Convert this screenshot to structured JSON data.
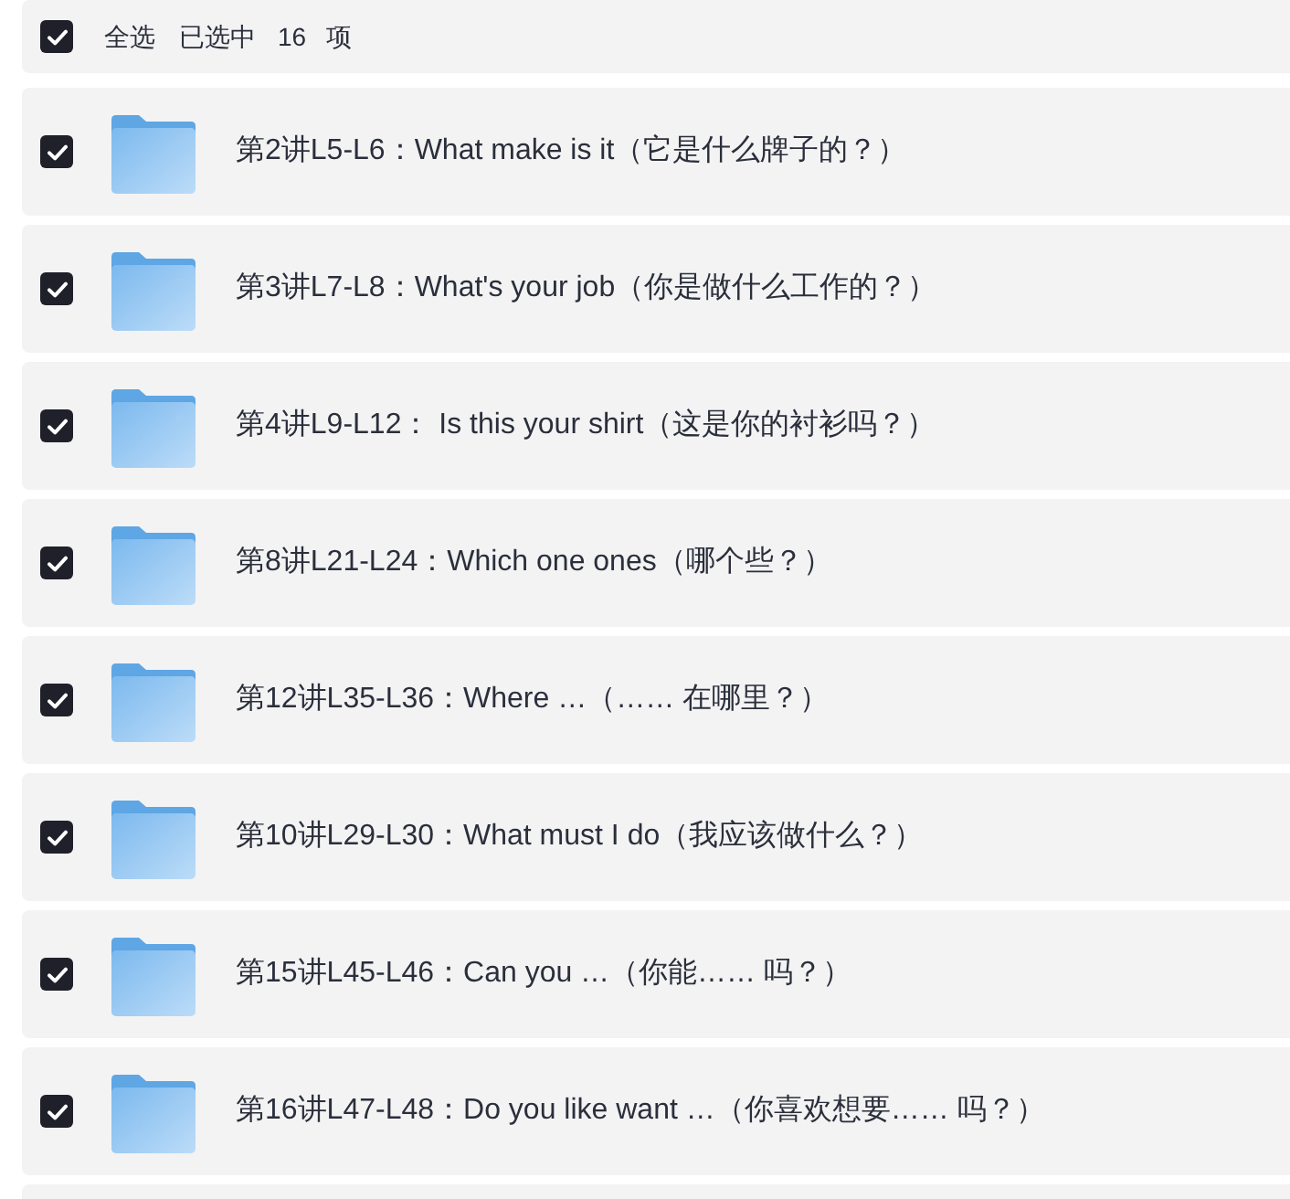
{
  "header": {
    "select_all": {
      "label": "全选",
      "checked": true
    },
    "selected_label": "已选中",
    "selected_count": "16",
    "unit": "项"
  },
  "items": [
    {
      "title": "第2讲L5-L6：What make is it（它是什么牌子的？）",
      "checked": true
    },
    {
      "title": "第3讲L7-L8：What's your job（你是做什么工作的？）",
      "checked": true
    },
    {
      "title": "第4讲L9-L12： Is this your shirt（这是你的衬衫吗？）",
      "checked": true
    },
    {
      "title": "第8讲L21-L24：Which one ones（哪个些？）",
      "checked": true
    },
    {
      "title": "第12讲L35-L36：Where …（…… 在哪里？）",
      "checked": true
    },
    {
      "title": "第10讲L29-L30：What must I do（我应该做什么？）",
      "checked": true
    },
    {
      "title": "第15讲L45-L46：Can you …（你能…… 吗？）",
      "checked": true
    },
    {
      "title": "第16讲L47-L48：Do you like want …（你喜欢想要…… 吗？）",
      "checked": true
    }
  ]
}
